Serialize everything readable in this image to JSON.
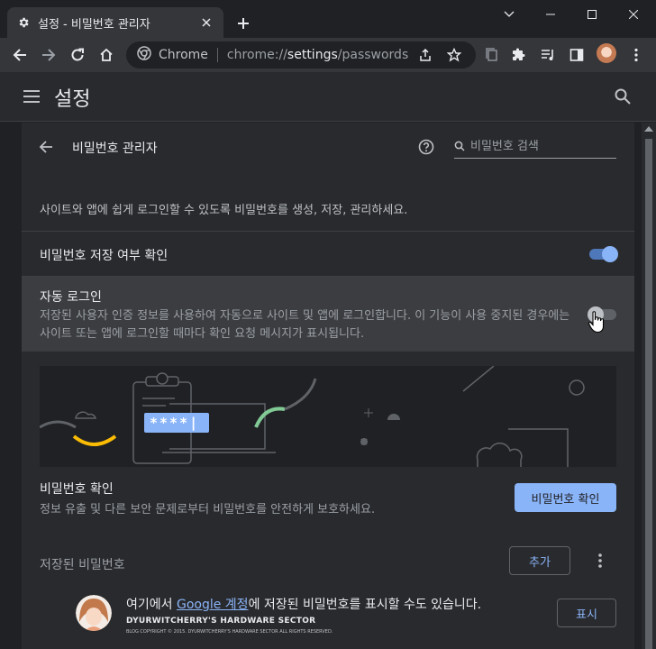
{
  "browser": {
    "tab_title": "설정 - 비밀번호 관리자",
    "omnibox_site": "Chrome",
    "omnibox_scheme": "chrome://",
    "omnibox_host": "settings",
    "omnibox_path": "/passwords"
  },
  "settings": {
    "title": "설정"
  },
  "password_manager": {
    "title": "비밀번호 관리자",
    "search_placeholder": "비밀번호 검색",
    "description": "사이트와 앱에 쉽게 로그인할 수 있도록 비밀번호를 생성, 저장, 관리하세요.",
    "offer_to_save": {
      "label": "비밀번호 저장 여부 확인",
      "enabled": true
    },
    "auto_signin": {
      "label": "자동 로그인",
      "description": "저장된 사용자 인증 정보를 사용하여 자동으로 사이트 및 앱에 로그인합니다. 이 기능이 사용 중지된 경우에는 사이트 또는 앱에 로그인할 때마다 확인 요청 메시지가 표시됩니다.",
      "enabled": false
    },
    "illustration": {
      "password_mask": "****|"
    },
    "check": {
      "title": "비밀번호 확인",
      "description": "정보 유출 및 다른 보안 문제로부터 비밀번호를 안전하게 보호하세요.",
      "button": "비밀번호 확인"
    },
    "saved": {
      "title": "저장된 비밀번호",
      "add_button": "추가"
    },
    "account_info": {
      "prefix": "여기에서 ",
      "link": "Google 계정",
      "suffix": "에 저장된 비밀번호를 표시할 수도 있습니다.",
      "show_button": "표시"
    },
    "watermark": {
      "title": "DYURWITCHERRY'S HARDWARE SECTOR",
      "subtitle": "BLOG COPYRIGHT © 2015. DYURWITCHERRY'S HARDWARE SECTOR ALL RIGHTS RESERVED."
    }
  },
  "colors": {
    "accent": "#8ab4f8",
    "background": "#202124",
    "surface": "#292a2d",
    "toolbar": "#35363a",
    "illus_yellow": "#fbbc04",
    "illus_green": "#81c995"
  }
}
